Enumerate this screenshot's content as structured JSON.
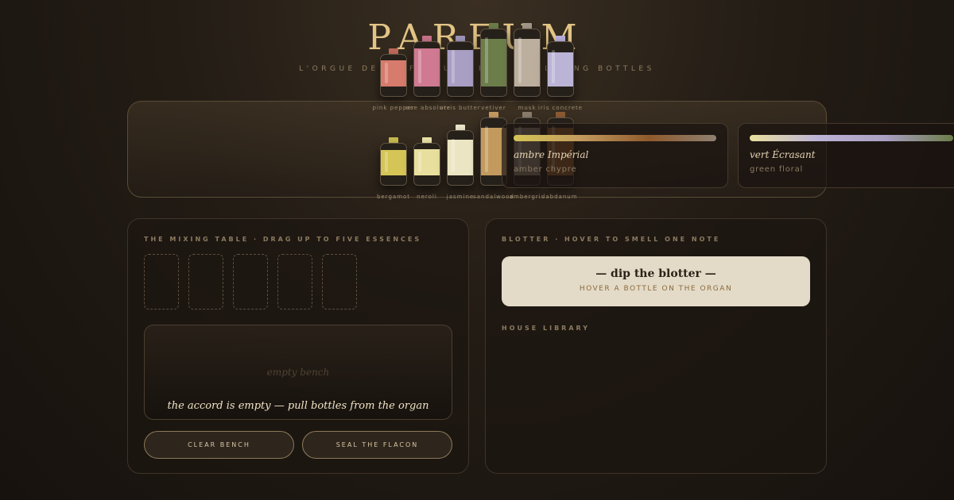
{
  "header": {
    "title": "PARFUM",
    "subtitle": "L'ORGUE DE PARFUMEUR · PICK BY PLAYING BOTTLES"
  },
  "organ": {
    "rows": [
      [
        {
          "name": "pink pepper",
          "color": "#d77b6c",
          "cap": "#c06a5a",
          "level": 0.72
        },
        {
          "name": "rose absolute",
          "color": "#cf7a92",
          "cap": "#c77389",
          "level": 0.78
        },
        {
          "name": "orris butter",
          "color": "#a99ec3",
          "cap": "#9e94b8",
          "level": 0.75
        },
        {
          "name": "vetiver",
          "color": "#6b7d49",
          "cap": "#6b7d49",
          "level": 0.78
        },
        {
          "name": "musk",
          "color": "#bdaf9e",
          "cap": "#a49889",
          "level": 0.78
        },
        {
          "name": "iris concrete",
          "color": "#bcb4d6",
          "cap": "#b6aedb",
          "level": 0.7
        }
      ],
      [
        {
          "name": "bergamot",
          "color": "#d4c556",
          "cap": "#c7b94e",
          "level": 0.7
        },
        {
          "name": "neroli",
          "color": "#e8df9e",
          "cap": "#eae2a8",
          "level": 0.72
        },
        {
          "name": "jasmine",
          "color": "#ece5c3",
          "cap": "#ede7cb",
          "level": 0.74
        },
        {
          "name": "sandalwood",
          "color": "#c29a5e",
          "cap": "#c59a62",
          "level": 0.78
        },
        {
          "name": "ambergris",
          "color": "#8e8070",
          "cap": "#8a7d6e",
          "level": 0.78
        },
        {
          "name": "labdanum",
          "color": "#8f5a2c",
          "cap": "#8c5b34",
          "level": 0.78
        }
      ]
    ]
  },
  "mixing": {
    "heading": "THE MIXING TABLE · DRAG UP TO FIVE ESSENCES",
    "bench_placeholder": "empty bench",
    "status": "the accord is empty — pull bottles from the organ",
    "clear_label": "CLEAR BENCH",
    "seal_label": "SEAL THE FLACON"
  },
  "blotter": {
    "heading": "BLOTTER · HOVER TO SMELL ONE NOTE",
    "title": "— dip the blotter —",
    "hint": "HOVER A BOTTLE ON THE ORGAN"
  },
  "library": {
    "heading": "HOUSE LIBRARY",
    "items": [
      {
        "name": "ambre Impérial",
        "family": "amber chypre",
        "gradient": [
          "#d4c556",
          "#c29a5e",
          "#8f5a2c",
          "#8e8070"
        ]
      },
      {
        "name": "vert Écrasant",
        "family": "green floral",
        "gradient": [
          "#e8df9e",
          "#bcb4d6",
          "#a99ec3",
          "#6b7d49"
        ]
      }
    ]
  }
}
